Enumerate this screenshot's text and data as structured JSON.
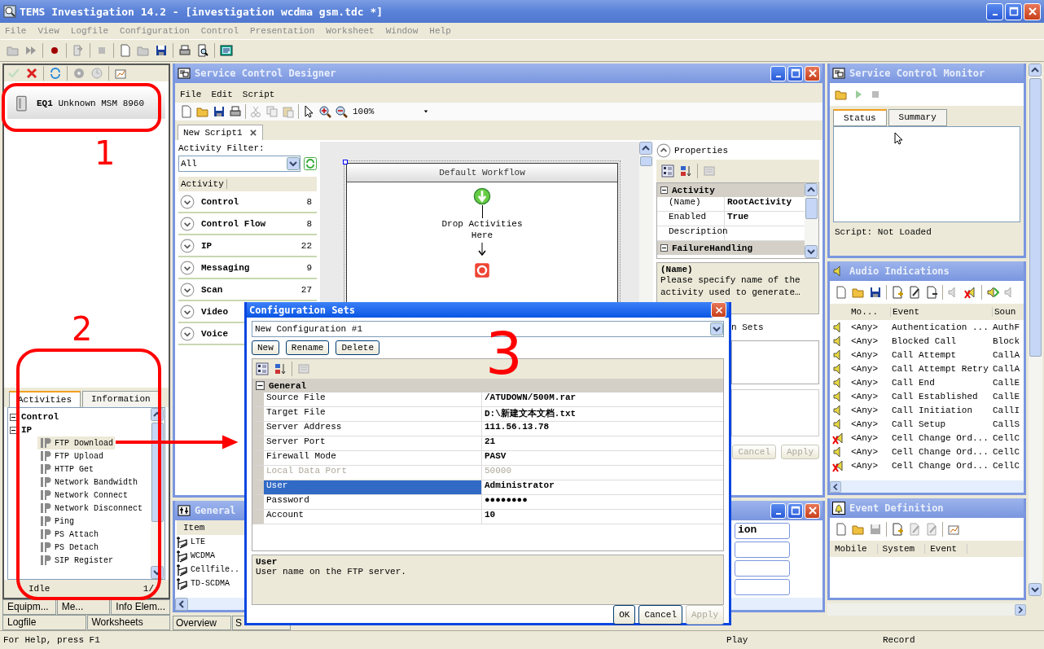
{
  "window": {
    "title": "TEMS Investigation 14.2 - [investigation wcdma gsm.tdc *]"
  },
  "menu": [
    "File",
    "View",
    "Logfile",
    "Configuration",
    "Control",
    "Presentation",
    "Worksheet",
    "Window",
    "Help"
  ],
  "equipment_panel": {
    "items": [
      {
        "label": "**EQ1** Unknown MSM 8960"
      }
    ],
    "tabs": [
      {
        "label": "Activities",
        "selected": true
      },
      {
        "label": "Information",
        "selected": false
      }
    ],
    "tree": [
      {
        "label": "Control",
        "expanded": true
      },
      {
        "label": "IP",
        "expanded": true,
        "children": [
          {
            "label": "FTP Download",
            "selected": true
          },
          {
            "label": "FTP Upload",
            "selected": false
          },
          {
            "label": "HTTP Get",
            "selected": false
          },
          {
            "label": "Network Bandwidth",
            "selected": false
          },
          {
            "label": "Network Connect",
            "selected": false
          },
          {
            "label": "Network Disconnect",
            "selected": false
          },
          {
            "label": "Ping",
            "selected": false
          },
          {
            "label": "PS Attach",
            "selected": false
          },
          {
            "label": "PS Detach",
            "selected": false
          },
          {
            "label": "SIP Register",
            "selected": false
          }
        ]
      }
    ],
    "status": "Idle",
    "page": "1/",
    "bottom_tabs": [
      [
        "Equipm...",
        "Me...",
        "Info Elem..."
      ],
      [
        "Logfile",
        "Worksheets"
      ]
    ]
  },
  "designer": {
    "title": "Service Control Designer",
    "menu": [
      "File",
      "Edit",
      "Script"
    ],
    "zoom": "100%",
    "doc_tab": "New Script1",
    "filter_label": "Activity Filter:",
    "filter_value": "All",
    "column": "Activity",
    "groups": [
      {
        "name": "Control",
        "count": "8"
      },
      {
        "name": "Control Flow",
        "count": "8"
      },
      {
        "name": "IP",
        "count": "22"
      },
      {
        "name": "Messaging",
        "count": "9"
      },
      {
        "name": "Scan",
        "count": "27"
      },
      {
        "name": "Video"
      },
      {
        "name": "Voice"
      }
    ],
    "workflow": {
      "title": "Default Workflow",
      "drop_text": "Drop Activities Here"
    },
    "properties": {
      "title": "Properties",
      "sections": [
        {
          "name": "Activity",
          "rows": [
            {
              "name": "(Name)",
              "value": "RootActivity"
            },
            {
              "name": "Enabled",
              "value": "True"
            },
            {
              "name": "Description"
            }
          ]
        },
        {
          "name": "FailureHandling"
        }
      ],
      "help_title": "(Name)",
      "help_text": "Please specify name of the activity used to generate…",
      "fragment": "n Sets",
      "buttons": [
        {
          "label": "Cancel",
          "disabled": true
        },
        {
          "label": "Apply",
          "disabled": true
        }
      ]
    }
  },
  "general_window": {
    "title": "General",
    "column": "Item",
    "items": [
      "LTE",
      "WCDMA",
      "Cellfile..",
      "TD-SCDMA"
    ],
    "fragment": "ion",
    "tabs": [
      "Overview",
      "S"
    ]
  },
  "monitor": {
    "title": "Service Control Monitor",
    "tabs": [
      {
        "label": "Status",
        "selected": true
      },
      {
        "label": "Summary",
        "selected": false
      }
    ],
    "script_status": "Script: Not Loaded"
  },
  "audio": {
    "title": "Audio Indications",
    "columns": [
      "Mo...",
      "Event",
      "Soun"
    ],
    "rows": [
      {
        "muted": false,
        "mobile": "<Any>",
        "event": "Authentication ...",
        "sound": "AuthF"
      },
      {
        "muted": false,
        "mobile": "<Any>",
        "event": "Blocked Call",
        "sound": "Block"
      },
      {
        "muted": false,
        "mobile": "<Any>",
        "event": "Call Attempt",
        "sound": "CallA"
      },
      {
        "muted": false,
        "mobile": "<Any>",
        "event": "Call Attempt Retry",
        "sound": "CallA"
      },
      {
        "muted": false,
        "mobile": "<Any>",
        "event": "Call End",
        "sound": "CallE"
      },
      {
        "muted": false,
        "mobile": "<Any>",
        "event": "Call Established",
        "sound": "CallE"
      },
      {
        "muted": false,
        "mobile": "<Any>",
        "event": "Call Initiation",
        "sound": "CallI"
      },
      {
        "muted": false,
        "mobile": "<Any>",
        "event": "Call Setup",
        "sound": "CallS"
      },
      {
        "muted": true,
        "mobile": "<Any>",
        "event": "Cell Change Ord...",
        "sound": "CellC"
      },
      {
        "muted": false,
        "mobile": "<Any>",
        "event": "Cell Change Ord...",
        "sound": "CellC"
      },
      {
        "muted": true,
        "mobile": "<Any>",
        "event": "Cell Change Ord...",
        "sound": "CellC"
      }
    ]
  },
  "event_definition": {
    "title": "Event Definition",
    "columns": [
      "Mobile",
      "System",
      "Event"
    ]
  },
  "dialog": {
    "title": "Configuration Sets",
    "config": "New Configuration #1",
    "buttons": [
      "New",
      "Rename",
      "Delete"
    ],
    "section": "General",
    "rows": [
      {
        "name": "Source File",
        "value": "/ATUDOWN/500M.rar",
        "selected": false,
        "disabled": false
      },
      {
        "name": "Target File",
        "value": "D:\\新建文本文档.txt",
        "selected": false,
        "disabled": false
      },
      {
        "name": "Server Address",
        "value": "111.56.13.78",
        "selected": false,
        "disabled": false
      },
      {
        "name": "Server Port",
        "value": "21",
        "selected": false,
        "disabled": false
      },
      {
        "name": "Firewall Mode",
        "value": "PASV",
        "selected": false,
        "disabled": false
      },
      {
        "name": "Local Data Port",
        "value": "50000",
        "selected": false,
        "disabled": true
      },
      {
        "name": "User",
        "value": "Administrator",
        "selected": true,
        "disabled": false
      },
      {
        "name": "Password",
        "value": "●●●●●●●●",
        "selected": false,
        "disabled": false
      },
      {
        "name": "Account",
        "value": "10",
        "selected": false,
        "disabled": false
      }
    ],
    "help": {
      "title": "User",
      "text": "User name on the FTP server."
    },
    "footer_buttons": [
      {
        "label": "OK",
        "disabled": false
      },
      {
        "label": "Cancel",
        "disabled": false
      },
      {
        "label": "Apply",
        "disabled": true
      }
    ]
  },
  "status_bar": [
    "For Help, press F1",
    "Play",
    "Record"
  ],
  "annotations": [
    {
      "label": "1"
    },
    {
      "label": "2"
    },
    {
      "label": "3"
    }
  ]
}
